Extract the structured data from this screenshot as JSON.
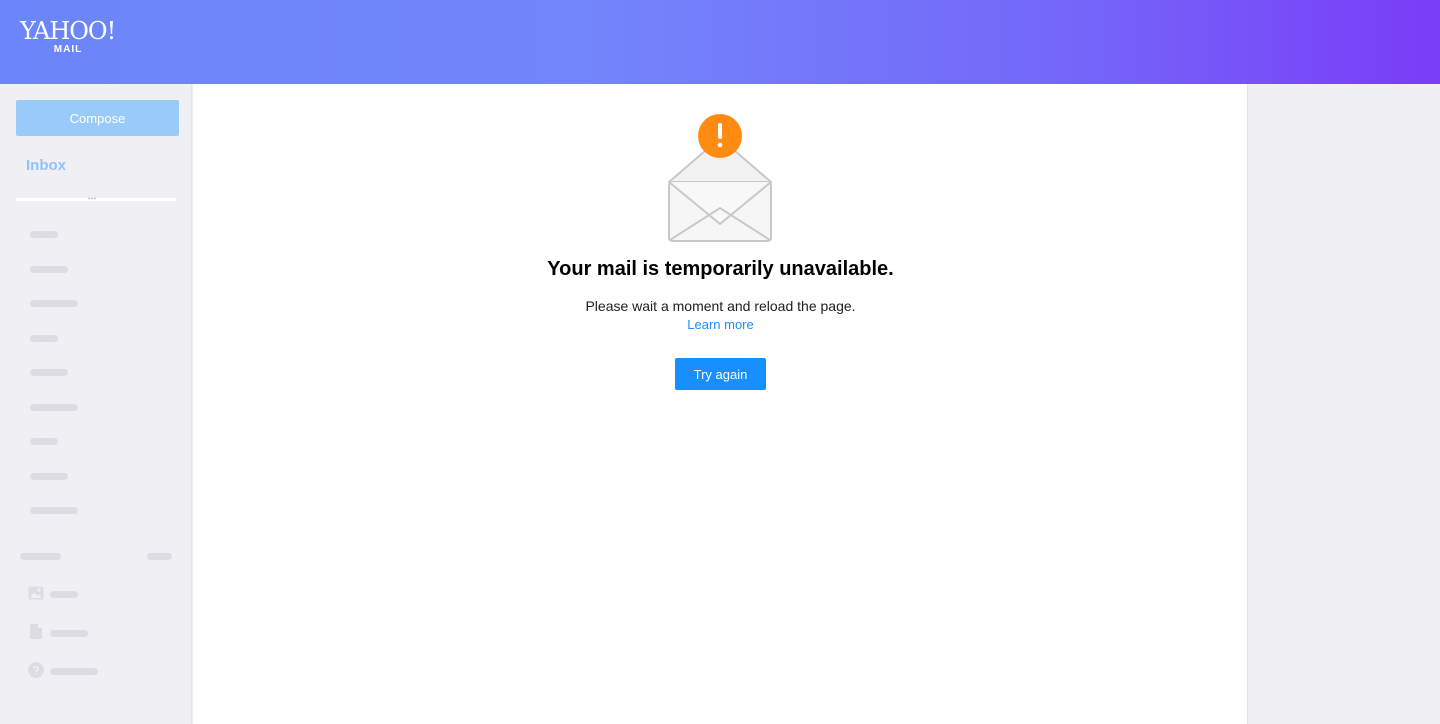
{
  "header": {
    "logo_text": "YAHOO!",
    "logo_subtext": "MAIL",
    "gradient_start": "#6b86fa",
    "gradient_end": "#7a3cf7"
  },
  "sidebar": {
    "compose_label": "Compose",
    "inbox_label": "Inbox",
    "more_label": "...",
    "footer_icons": [
      "image-icon",
      "document-icon",
      "help-icon"
    ]
  },
  "error": {
    "icon": "warning-envelope-icon",
    "title": "Your mail is temporarily unavailable.",
    "message": "Please wait a moment and reload the page.",
    "learn_more": "Learn more",
    "try_again": "Try again",
    "accent_color": "#188fff",
    "warning_color": "#ff8b12"
  }
}
